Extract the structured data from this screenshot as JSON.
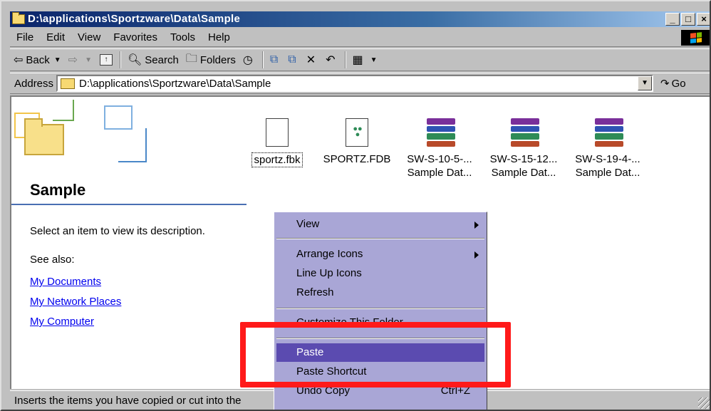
{
  "window": {
    "title": "D:\\applications\\Sportzware\\Data\\Sample",
    "btn_min": "_",
    "btn_max": "□",
    "btn_close": "×"
  },
  "menu": {
    "file": "File",
    "edit": "Edit",
    "view": "View",
    "favorites": "Favorites",
    "tools": "Tools",
    "help": "Help"
  },
  "toolbar": {
    "back": "Back",
    "search": "Search",
    "folders": "Folders"
  },
  "address": {
    "label": "Address",
    "value": "D:\\applications\\Sportzware\\Data\\Sample",
    "go": "Go"
  },
  "left_panel": {
    "folder_title": "Sample",
    "description": "Select an item to view its description.",
    "see_also": "See also:",
    "links": [
      "My Documents",
      "My Network Places",
      "My Computer"
    ]
  },
  "files": [
    {
      "name": "sportz.fbk",
      "line2": "",
      "type": "doc-windows"
    },
    {
      "name": "SPORTZ.FDB",
      "line2": "",
      "type": "doc-db"
    },
    {
      "name": "SW-S-10-5-...",
      "line2": "Sample Dat...",
      "type": "rar"
    },
    {
      "name": "SW-S-15-12...",
      "line2": "Sample Dat...",
      "type": "rar"
    },
    {
      "name": "SW-S-19-4-...",
      "line2": "Sample Dat...",
      "type": "rar"
    }
  ],
  "context_menu": {
    "view": "View",
    "arrange_icons": "Arrange Icons",
    "line_up_icons": "Line Up Icons",
    "refresh": "Refresh",
    "customize": "Customize This Folder...",
    "paste": "Paste",
    "paste_shortcut": "Paste Shortcut",
    "undo_copy": "Undo Copy",
    "undo_accel": "Ctrl+Z"
  },
  "status": {
    "text": "Inserts the items you have copied or cut into the"
  },
  "colors": {
    "menu_bg": "#a9a6d6",
    "menu_highlight": "#5b4bb0",
    "annotation": "#ff1a1a"
  }
}
